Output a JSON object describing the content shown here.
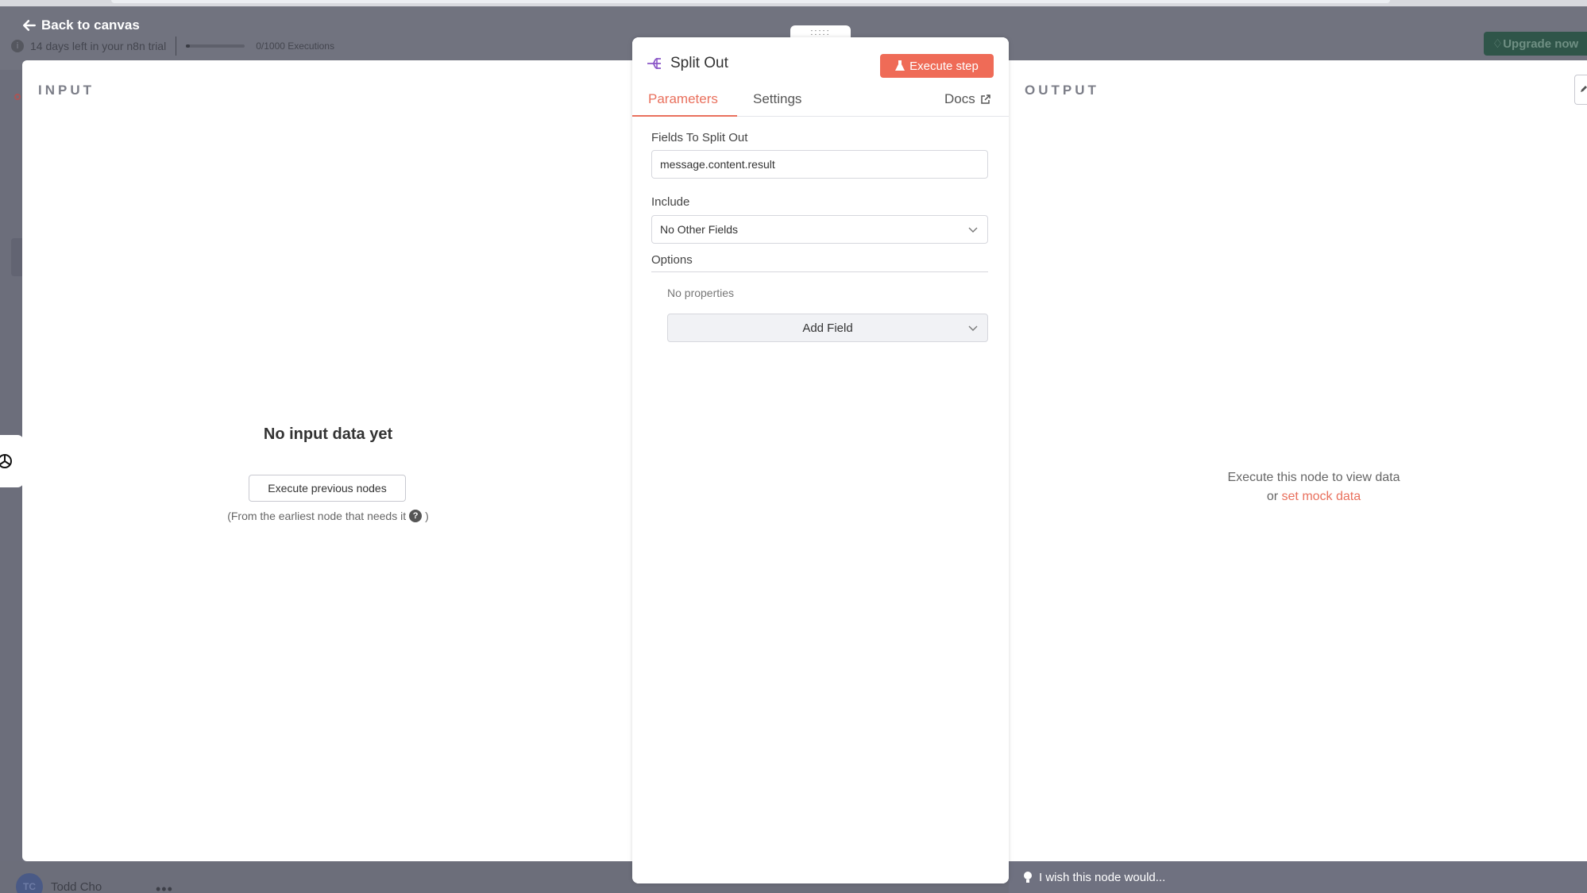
{
  "topbar": {
    "back_label": "Back to canvas",
    "trial_text": "14 days left in your n8n trial",
    "executions_text": "0/1000 Executions",
    "executions_progress": 0.02,
    "upgrade_label": "Upgrade now"
  },
  "user": {
    "initials": "TC",
    "name": "Todd Cho"
  },
  "input_panel": {
    "title": "INPUT",
    "empty_title": "No input data yet",
    "execute_previous_label": "Execute previous nodes",
    "hint_text": "(From the earliest node that needs it",
    "hint_close": ")"
  },
  "node": {
    "title": "Split Out",
    "execute_label": "Execute step",
    "tabs": {
      "parameters": "Parameters",
      "settings": "Settings",
      "docs": "Docs"
    },
    "fields_label": "Fields To Split Out",
    "fields_value": "message.content.result",
    "include_label": "Include",
    "include_value": "No Other Fields",
    "options_label": "Options",
    "no_properties": "No properties",
    "add_field_label": "Add Field"
  },
  "output_panel": {
    "title": "OUTPUT",
    "hint_line1": "Execute this node to view data",
    "hint_or": "or",
    "mock_link": "set mock data"
  },
  "wish_text": "I wish this node would...",
  "colors": {
    "accent": "#ef6b57",
    "node_icon": "#8b57c7",
    "upgrade": "#2f5549"
  }
}
